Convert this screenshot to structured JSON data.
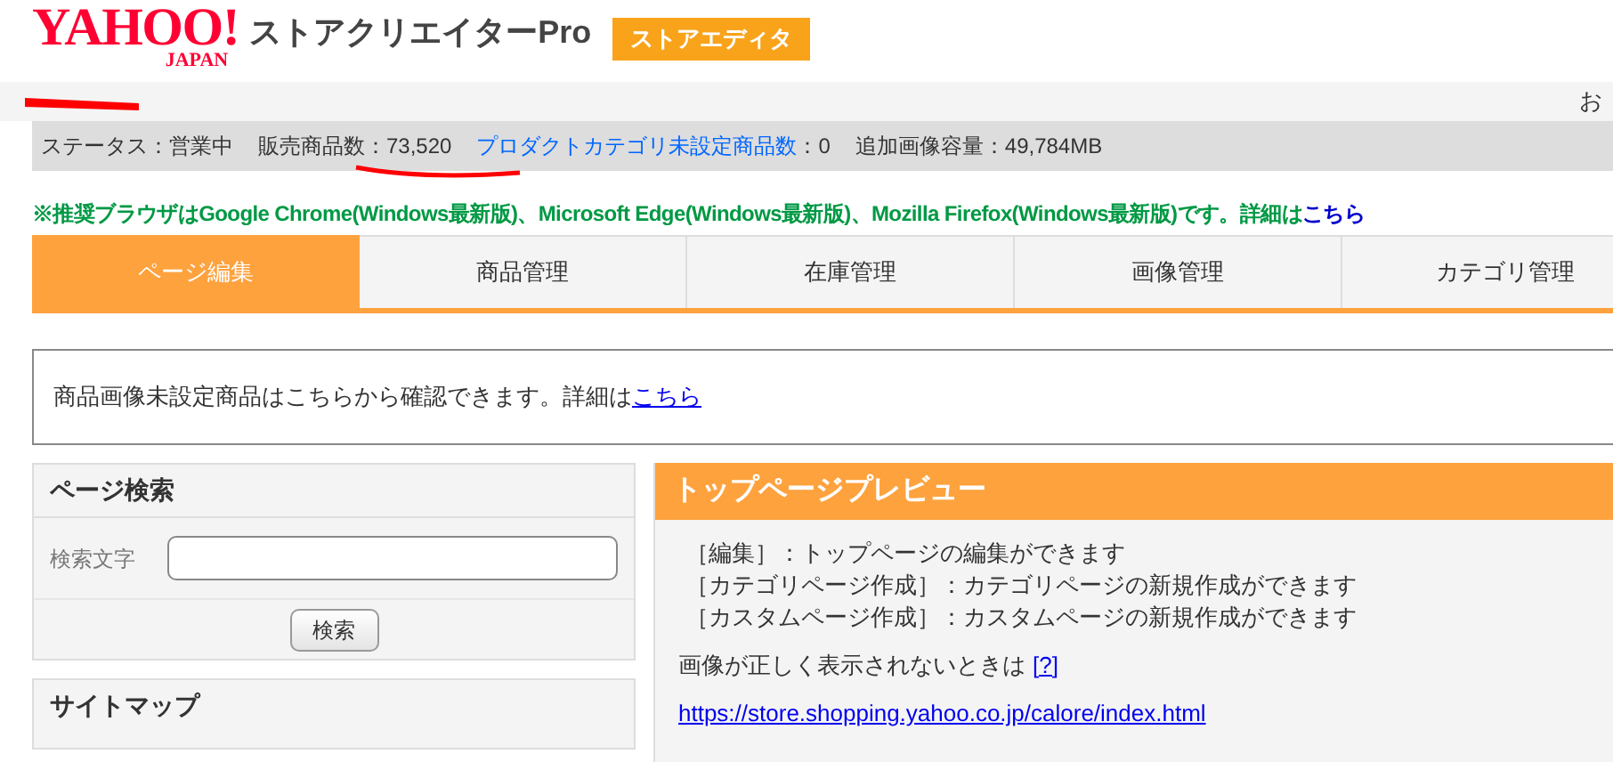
{
  "header": {
    "logo": "YAHOO!",
    "logo_sub": "JAPAN",
    "product": "ストアクリエイターPro",
    "badge": "ストアエディタ"
  },
  "account_bar": {
    "text": "お"
  },
  "status_bar": [
    {
      "label": "ステータス：営業中",
      "kind": "text"
    },
    {
      "label": "販売商品数：73,520",
      "kind": "text"
    },
    {
      "label": "プロダクトカテゴリ未設定商品数",
      "value": "：0",
      "kind": "link"
    },
    {
      "label": "追加画像容量：49,784MB",
      "kind": "text"
    }
  ],
  "notice": {
    "text": "※推奨ブラウザはGoogle Chrome(Windows最新版)、Microsoft Edge(Windows最新版)、Mozilla Firefox(Windows最新版)です。詳細は",
    "link": "こちら"
  },
  "tabs": [
    {
      "label": "ページ編集",
      "selected": true
    },
    {
      "label": "商品管理",
      "selected": false
    },
    {
      "label": "在庫管理",
      "selected": false
    },
    {
      "label": "画像管理",
      "selected": false
    },
    {
      "label": "カテゴリ管理",
      "selected": false
    }
  ],
  "info_box": {
    "text": "商品画像未設定商品はこちらから確認できます。詳細は",
    "link": "こちら"
  },
  "page_search": {
    "title": "ページ検索",
    "field_label": "検索文字",
    "button": "検索"
  },
  "sitemap": {
    "title": "サイトマップ"
  },
  "preview": {
    "title": "トップページプレビュー",
    "lines": [
      "［編集］：トップページの編集ができます",
      "［カテゴリページ作成］：カテゴリページの新規作成ができます",
      "［カスタムページ作成］：カスタムページの新規作成ができます"
    ],
    "image_note": "画像が正しく表示されないときは",
    "help_link": "[?]",
    "url": "https://store.shopping.yahoo.co.jp/calore/index.html"
  }
}
